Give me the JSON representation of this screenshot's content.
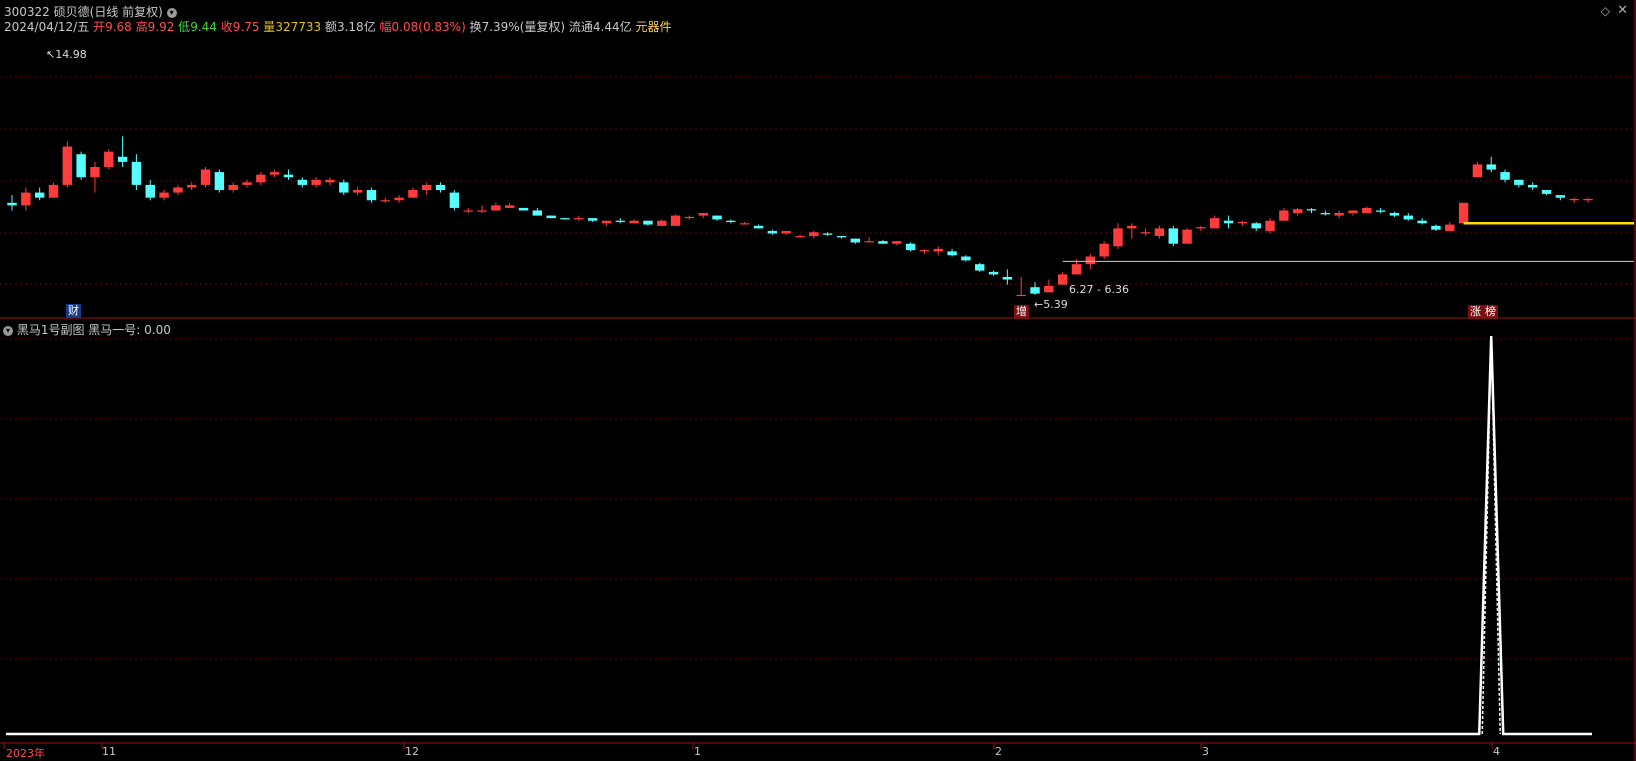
{
  "header": {
    "code": "300322",
    "name": "硕贝德",
    "mode": "(日线 前复权)",
    "date": "2024/04/12/五",
    "open_label": "开",
    "open": "9.68",
    "high_label": "高",
    "high": "9.92",
    "low_label": "低",
    "low": "9.44",
    "close_label": "收",
    "close": "9.75",
    "vol_label": "量",
    "vol": "327733",
    "amount_label": "额",
    "amount": "3.18亿",
    "chg_label": "幅",
    "chg": "0.08(0.83%)",
    "turnover": "换7.39%(量复权)",
    "float": "流通4.44亿",
    "sector": "元器件"
  },
  "main_chart": {
    "high_marker": "14.98",
    "low_marker": "5.39",
    "range_label": "6.27 - 6.36",
    "badges": {
      "cai": "财",
      "zeng": "增",
      "zhang": "涨",
      "bang": "榜"
    }
  },
  "sub_chart": {
    "title": "黑马1号副图",
    "series_label": "黑马一号:",
    "series_value": "0.00"
  },
  "x_axis": {
    "labels": [
      "2023年",
      "11",
      "12",
      "1",
      "2",
      "3",
      "4"
    ]
  },
  "colors": {
    "up": "#ff3b3b",
    "down": "#54ffff",
    "grid": "#6a0000",
    "frame": "#a01010",
    "white": "#ffffff",
    "yellow_line": "#ffe000"
  },
  "chart_data": {
    "type": "candlestick",
    "candles": [
      [
        8.6,
        8.9,
        8.3,
        8.5
      ],
      [
        8.5,
        9.2,
        8.3,
        9.0
      ],
      [
        9.0,
        9.2,
        8.7,
        8.8
      ],
      [
        8.8,
        9.4,
        8.8,
        9.3
      ],
      [
        9.3,
        11.0,
        9.2,
        10.8
      ],
      [
        10.5,
        10.6,
        9.5,
        9.6
      ],
      [
        9.6,
        10.2,
        9.0,
        10.0
      ],
      [
        10.0,
        10.7,
        9.9,
        10.6
      ],
      [
        10.4,
        11.2,
        10.0,
        10.2
      ],
      [
        10.2,
        10.5,
        9.1,
        9.3
      ],
      [
        9.3,
        9.5,
        8.7,
        8.8
      ],
      [
        8.8,
        9.1,
        8.7,
        9.0
      ],
      [
        9.0,
        9.3,
        8.9,
        9.2
      ],
      [
        9.2,
        9.4,
        9.1,
        9.3
      ],
      [
        9.3,
        10.0,
        9.2,
        9.9
      ],
      [
        9.8,
        9.9,
        9.0,
        9.1
      ],
      [
        9.1,
        9.4,
        9.0,
        9.3
      ],
      [
        9.3,
        9.5,
        9.2,
        9.4
      ],
      [
        9.4,
        9.8,
        9.3,
        9.7
      ],
      [
        9.7,
        9.9,
        9.6,
        9.8
      ],
      [
        9.7,
        9.9,
        9.5,
        9.6
      ],
      [
        9.5,
        9.6,
        9.2,
        9.3
      ],
      [
        9.3,
        9.6,
        9.2,
        9.5
      ],
      [
        9.4,
        9.6,
        9.3,
        9.5
      ],
      [
        9.4,
        9.5,
        8.9,
        9.0
      ],
      [
        9.0,
        9.2,
        8.9,
        9.1
      ],
      [
        9.1,
        9.2,
        8.6,
        8.7
      ],
      [
        8.7,
        8.8,
        8.6,
        8.7
      ],
      [
        8.7,
        8.9,
        8.6,
        8.8
      ],
      [
        8.8,
        9.2,
        8.8,
        9.1
      ],
      [
        9.1,
        9.4,
        8.9,
        9.3
      ],
      [
        9.3,
        9.4,
        9.0,
        9.1
      ],
      [
        9.0,
        9.1,
        8.3,
        8.4
      ],
      [
        8.3,
        8.4,
        8.2,
        8.3
      ],
      [
        8.3,
        8.5,
        8.2,
        8.3
      ],
      [
        8.3,
        8.6,
        8.3,
        8.5
      ],
      [
        8.4,
        8.6,
        8.4,
        8.5
      ],
      [
        8.4,
        8.4,
        8.3,
        8.3
      ],
      [
        8.3,
        8.4,
        8.1,
        8.1
      ],
      [
        8.1,
        8.1,
        8.0,
        8.0
      ],
      [
        8.0,
        8.0,
        7.95,
        7.95
      ],
      [
        7.95,
        8.1,
        7.9,
        8.0
      ],
      [
        8.0,
        8.0,
        7.85,
        7.9
      ],
      [
        7.8,
        7.9,
        7.7,
        7.9
      ],
      [
        7.9,
        8.0,
        7.8,
        7.85
      ],
      [
        7.8,
        7.95,
        7.8,
        7.9
      ],
      [
        7.9,
        7.9,
        7.7,
        7.75
      ],
      [
        7.7,
        7.95,
        7.7,
        7.9
      ],
      [
        7.7,
        8.15,
        7.7,
        8.1
      ],
      [
        8.0,
        8.1,
        7.95,
        8.05
      ],
      [
        8.1,
        8.2,
        8.0,
        8.2
      ],
      [
        8.1,
        8.1,
        7.9,
        7.95
      ],
      [
        7.9,
        7.95,
        7.8,
        7.85
      ],
      [
        7.8,
        7.85,
        7.75,
        7.8
      ],
      [
        7.7,
        7.75,
        7.6,
        7.6
      ],
      [
        7.5,
        7.55,
        7.35,
        7.4
      ],
      [
        7.4,
        7.5,
        7.35,
        7.5
      ],
      [
        7.3,
        7.35,
        7.25,
        7.3
      ],
      [
        7.3,
        7.5,
        7.2,
        7.45
      ],
      [
        7.4,
        7.45,
        7.3,
        7.35
      ],
      [
        7.3,
        7.3,
        7.2,
        7.25
      ],
      [
        7.2,
        7.2,
        7.0,
        7.05
      ],
      [
        7.1,
        7.25,
        7.05,
        7.1
      ],
      [
        7.1,
        7.15,
        7.0,
        7.0
      ],
      [
        7.0,
        7.1,
        6.95,
        7.1
      ],
      [
        7.0,
        7.05,
        6.7,
        6.75
      ],
      [
        6.7,
        6.8,
        6.6,
        6.75
      ],
      [
        6.7,
        6.9,
        6.55,
        6.8
      ],
      [
        6.7,
        6.8,
        6.5,
        6.55
      ],
      [
        6.5,
        6.55,
        6.3,
        6.35
      ],
      [
        6.2,
        6.25,
        5.9,
        5.95
      ],
      [
        5.9,
        5.95,
        5.75,
        5.8
      ],
      [
        5.7,
        6.0,
        5.4,
        5.6
      ],
      [
        5.0,
        5.7,
        5.0,
        5.0
      ],
      [
        5.3,
        5.5,
        5.0,
        5.05
      ],
      [
        5.1,
        5.6,
        5.2,
        5.35
      ],
      [
        5.4,
        5.9,
        5.4,
        5.8
      ],
      [
        5.8,
        6.4,
        5.8,
        6.2
      ],
      [
        6.2,
        6.6,
        6.0,
        6.5
      ],
      [
        6.5,
        7.1,
        6.4,
        7.0
      ],
      [
        6.9,
        7.8,
        6.8,
        7.6
      ],
      [
        7.6,
        7.8,
        7.2,
        7.7
      ],
      [
        7.4,
        7.6,
        7.3,
        7.45
      ],
      [
        7.3,
        7.7,
        7.2,
        7.6
      ],
      [
        7.6,
        7.7,
        6.9,
        7.0
      ],
      [
        7.0,
        7.6,
        7.0,
        7.55
      ],
      [
        7.6,
        7.7,
        7.5,
        7.65
      ],
      [
        7.6,
        8.1,
        7.6,
        8.0
      ],
      [
        7.9,
        8.1,
        7.6,
        7.8
      ],
      [
        7.8,
        7.9,
        7.7,
        7.85
      ],
      [
        7.8,
        7.85,
        7.5,
        7.6
      ],
      [
        7.5,
        8.0,
        7.4,
        7.9
      ],
      [
        7.9,
        8.4,
        7.9,
        8.3
      ],
      [
        8.2,
        8.4,
        8.1,
        8.35
      ],
      [
        8.35,
        8.4,
        8.2,
        8.3
      ],
      [
        8.2,
        8.3,
        8.1,
        8.15
      ],
      [
        8.1,
        8.3,
        8.0,
        8.2
      ],
      [
        8.2,
        8.3,
        8.1,
        8.3
      ],
      [
        8.2,
        8.45,
        8.2,
        8.4
      ],
      [
        8.3,
        8.4,
        8.2,
        8.25
      ],
      [
        8.2,
        8.25,
        8.05,
        8.1
      ],
      [
        8.1,
        8.2,
        7.9,
        7.95
      ],
      [
        7.9,
        8.0,
        7.75,
        7.8
      ],
      [
        7.7,
        7.75,
        7.5,
        7.55
      ],
      [
        7.5,
        7.85,
        7.5,
        7.75
      ],
      [
        7.8,
        8.6,
        7.8,
        8.6
      ],
      [
        9.6,
        10.2,
        9.8,
        10.1
      ],
      [
        10.1,
        10.4,
        9.8,
        9.9
      ],
      [
        9.8,
        9.9,
        9.4,
        9.5
      ],
      [
        9.5,
        9.5,
        9.2,
        9.3
      ],
      [
        9.3,
        9.4,
        9.1,
        9.2
      ],
      [
        9.1,
        9.1,
        8.9,
        8.95
      ],
      [
        8.9,
        8.9,
        8.7,
        8.8
      ],
      [
        8.7,
        8.8,
        8.6,
        8.75
      ],
      [
        8.7,
        8.8,
        8.6,
        8.75
      ]
    ],
    "sub_series": {
      "name": "黑马一号",
      "peak_index": 107,
      "peak_value": 100,
      "ylim": [
        0,
        100
      ]
    },
    "ylim": [
      4.8,
      15.2
    ],
    "flat_line": 6.31,
    "yellow_line": 7.8
  }
}
